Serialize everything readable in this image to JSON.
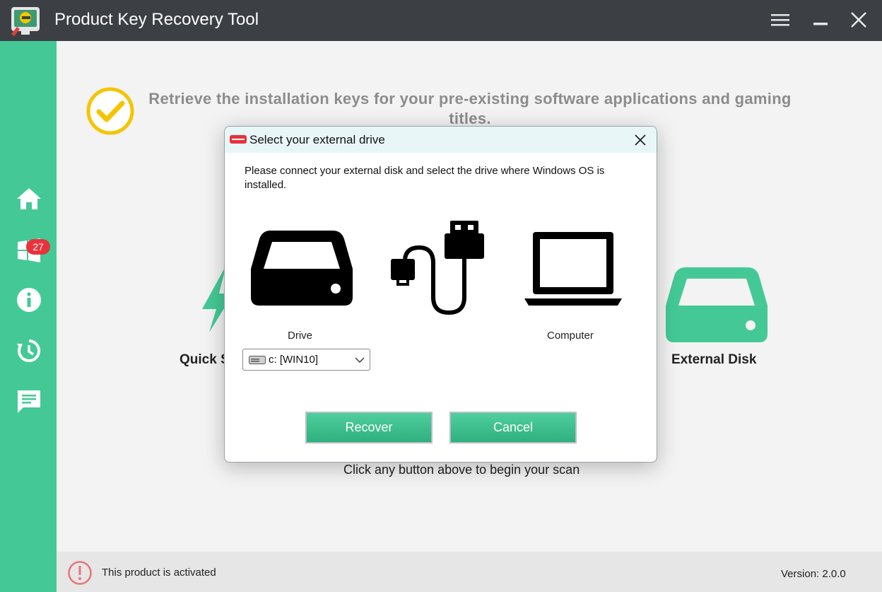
{
  "app": {
    "title": "Product Key Recovery Tool"
  },
  "titlebar": {
    "icons": [
      "menu-icon",
      "minimize-icon",
      "close-icon"
    ]
  },
  "sidebar": {
    "items": [
      {
        "icon": "home-icon"
      },
      {
        "icon": "windows-icon",
        "badge": "27"
      },
      {
        "icon": "info-icon"
      },
      {
        "icon": "history-icon"
      },
      {
        "icon": "feedback-icon"
      }
    ]
  },
  "main": {
    "headline": "Retrieve the installation keys for your pre-existing software applications and gaming titles.",
    "quick_label": "Quick S",
    "external_label": "External Disk",
    "hint": "Click any button above to begin your scan"
  },
  "status": {
    "text": "This product is activated",
    "version": "Version: 2.0.0"
  },
  "dialog": {
    "title": "Select your external drive",
    "message": "Please connect your external disk and select the drive where Windows OS is installed.",
    "drive_label": "Drive",
    "computer_label": "Computer",
    "drive_select_value": "c: [WIN10]",
    "recover_label": "Recover",
    "cancel_label": "Cancel"
  },
  "colors": {
    "accent": "#44c996",
    "titlebar": "#3c3f44",
    "badge": "#e8323c",
    "check": "#f5c400"
  }
}
